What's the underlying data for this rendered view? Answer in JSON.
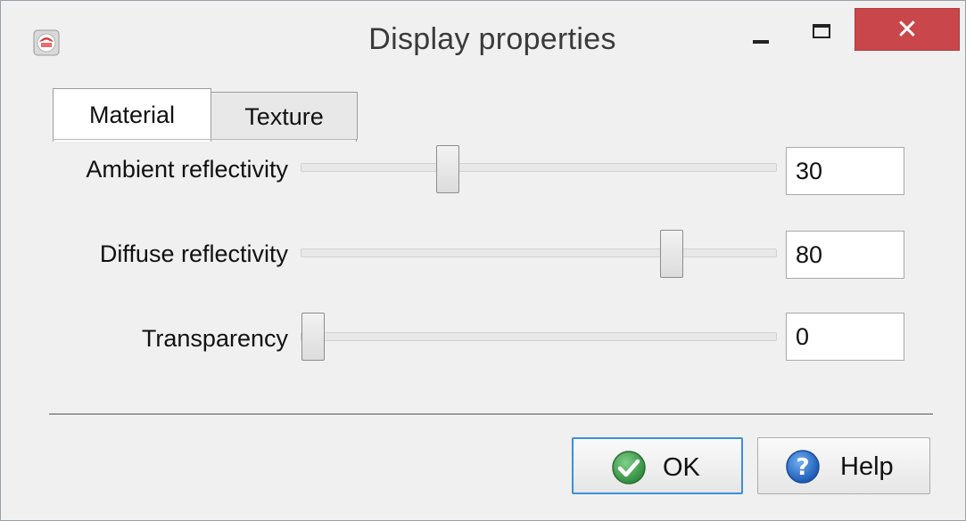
{
  "window": {
    "title": "Display properties",
    "close_glyph": "✕",
    "accent_close": "#c9474a"
  },
  "tabs": [
    {
      "label": "Material",
      "selected": true
    },
    {
      "label": "Texture",
      "selected": false
    }
  ],
  "material": {
    "rows": [
      {
        "label": "Ambient reflectivity",
        "value": "30",
        "level": 30
      },
      {
        "label": "Diffuse reflectivity",
        "value": "80",
        "level": 80
      },
      {
        "label": "Transparency",
        "value": "0",
        "level": 0
      }
    ]
  },
  "buttons": {
    "ok_label": "OK",
    "help_label": "Help"
  },
  "icons": {
    "app": "app-icon",
    "ok": "check-icon",
    "help": "help-icon"
  }
}
